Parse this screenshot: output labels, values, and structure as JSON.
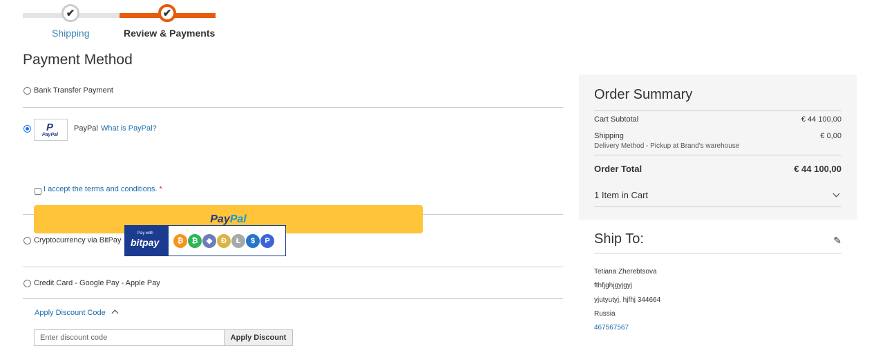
{
  "progress": {
    "steps": [
      {
        "label": "Shipping",
        "state": "done"
      },
      {
        "label": "Review & Payments",
        "state": "active"
      }
    ],
    "check_glyph": "✔"
  },
  "page_title": "Payment Method",
  "payment_methods": {
    "bank": {
      "label": "Bank Transfer Payment",
      "selected": false
    },
    "paypal": {
      "label": "PayPal",
      "link": "What is PayPal?",
      "logo_text": "PayPal",
      "terms": "I accept the terms and conditions.",
      "required_mark": "*",
      "button_pay": "Pay",
      "button_pal": "Pal",
      "selected": true
    },
    "crypto": {
      "label": "Cryptocurrency via BitPay",
      "bitpay_small": "Pay with",
      "bitpay_logo": "bitpay",
      "coins": [
        {
          "name": "bitcoin-icon",
          "glyph": "₿",
          "color": "#f7931a"
        },
        {
          "name": "bitcoin-cash-icon",
          "glyph": "₿",
          "color": "#2fb457"
        },
        {
          "name": "ethereum-icon",
          "glyph": "◆",
          "color": "#6f7cba"
        },
        {
          "name": "dogecoin-icon",
          "glyph": "Ð",
          "color": "#d8b545"
        },
        {
          "name": "litecoin-icon",
          "glyph": "Ł",
          "color": "#a6a9aa"
        },
        {
          "name": "usdc-icon",
          "glyph": "$",
          "color": "#2775ca"
        },
        {
          "name": "paypal-usd-icon",
          "glyph": "P",
          "color": "#3a64d8"
        }
      ],
      "selected": false
    },
    "card": {
      "label": "Credit Card - Google Pay - Apple Pay",
      "selected": false
    }
  },
  "discount": {
    "toggle_label": "Apply Discount Code",
    "placeholder": "Enter discount code",
    "button": "Apply Discount"
  },
  "summary": {
    "title": "Order Summary",
    "subtotal_label": "Cart Subtotal",
    "subtotal_value": "€ 44 100,00",
    "shipping_label": "Shipping",
    "shipping_value": "€ 0,00",
    "shipping_method": "Delivery Method - Pickup at Brand's warehouse",
    "total_label": "Order Total",
    "total_value": "€ 44 100,00",
    "items_in_cart": "1 Item in Cart"
  },
  "ship_to": {
    "title": "Ship To:",
    "edit_glyph": "✎",
    "name": "Tetiana Zherebtsova",
    "street": "fthfjghjgyjgyj",
    "city_line": "yjutyutyj, hjfhj 344664",
    "country": "Russia",
    "phone": "467567567"
  }
}
